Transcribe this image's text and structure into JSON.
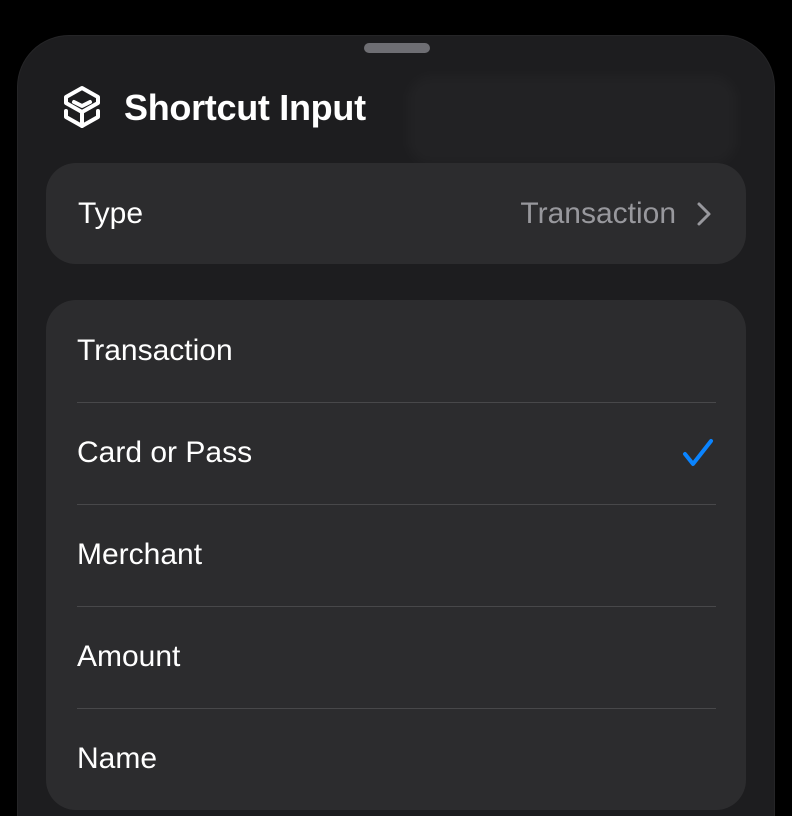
{
  "sheet": {
    "title": "Shortcut Input",
    "icon": "shortcuts-icon"
  },
  "type_row": {
    "label": "Type",
    "value": "Transaction",
    "icon": "chevron-right-icon"
  },
  "options": [
    {
      "label": "Transaction",
      "selected": false
    },
    {
      "label": "Card or Pass",
      "selected": true
    },
    {
      "label": "Merchant",
      "selected": false
    },
    {
      "label": "Amount",
      "selected": false
    },
    {
      "label": "Name",
      "selected": false
    }
  ],
  "colors": {
    "background": "#000000",
    "sheet": "#1d1d1f",
    "cell": "#2c2c2e",
    "separator": "#48484a",
    "secondary_text": "#98989d",
    "accent": "#0a84ff"
  }
}
